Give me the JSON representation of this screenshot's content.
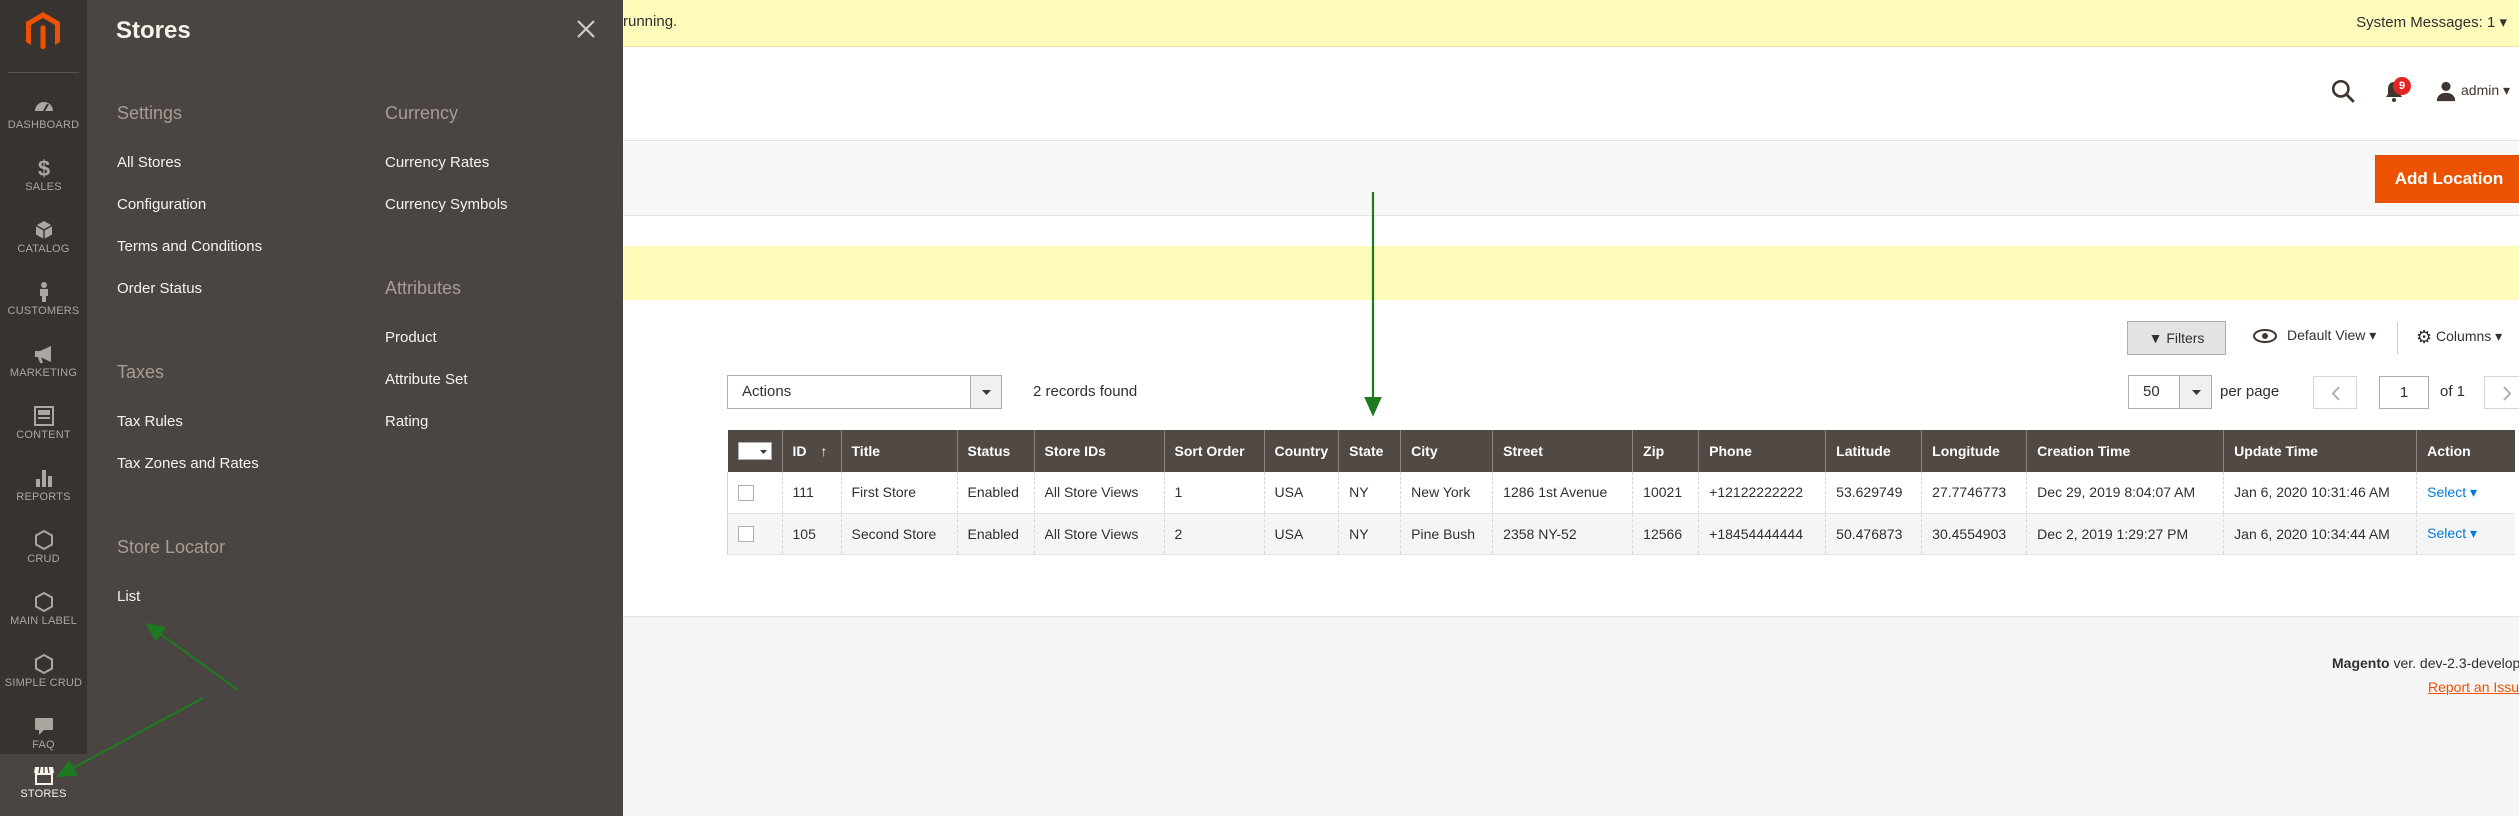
{
  "notice": {
    "text": "running.",
    "system_messages": "System Messages: 1"
  },
  "header": {
    "notifications_count": "9",
    "user": "admin"
  },
  "menu": {
    "items": [
      {
        "label": "DASHBOARD",
        "icon": "dashboard-icon"
      },
      {
        "label": "SALES",
        "icon": "dollar-icon"
      },
      {
        "label": "CATALOG",
        "icon": "cube-icon"
      },
      {
        "label": "CUSTOMERS",
        "icon": "person-icon"
      },
      {
        "label": "MARKETING",
        "icon": "megaphone-icon"
      },
      {
        "label": "CONTENT",
        "icon": "layout-icon"
      },
      {
        "label": "REPORTS",
        "icon": "bar-chart-icon"
      },
      {
        "label": "CRUD",
        "icon": "hexagon-icon"
      },
      {
        "label": "MAIN LABEL",
        "icon": "hexagon-icon"
      },
      {
        "label": "SIMPLE CRUD",
        "icon": "hexagon-icon"
      },
      {
        "label": "FAQ",
        "icon": "chat-icon"
      },
      {
        "label": "STORES",
        "icon": "store-icon"
      }
    ]
  },
  "flyout": {
    "title": "Stores",
    "settings": {
      "heading": "Settings",
      "links": [
        "All Stores",
        "Configuration",
        "Terms and Conditions",
        "Order Status"
      ]
    },
    "taxes": {
      "heading": "Taxes",
      "links": [
        "Tax Rules",
        "Tax Zones and Rates"
      ]
    },
    "store_locator": {
      "heading": "Store Locator",
      "links": [
        "List"
      ]
    },
    "currency": {
      "heading": "Currency",
      "links": [
        "Currency Rates",
        "Currency Symbols"
      ]
    },
    "attributes": {
      "heading": "Attributes",
      "links": [
        "Product",
        "Attribute Set",
        "Rating"
      ]
    }
  },
  "page_actions": {
    "add_label": "Add Location"
  },
  "toolbar": {
    "filters": "Filters",
    "default_view": "Default View",
    "columns": "Columns",
    "actions": "Actions",
    "records": "2 records found",
    "per_page_value": "50",
    "per_page_label": "per page",
    "page": "1",
    "of": "of 1"
  },
  "grid": {
    "columns": [
      "ID",
      "Title",
      "Status",
      "Store IDs",
      "Sort Order",
      "Country",
      "State",
      "City",
      "Street",
      "Zip",
      "Phone",
      "Latitude",
      "Longitude",
      "Creation Time",
      "Update Time",
      "Action"
    ],
    "rows": [
      [
        "111",
        "First Store",
        "Enabled",
        "All Store Views",
        "1",
        "USA",
        "NY",
        "New York",
        "1286 1st Avenue",
        "10021",
        "+12122222222",
        "53.629749",
        "27.7746773",
        "Dec 29, 2019 8:04:07 AM",
        "Jan 6, 2020 10:31:46 AM",
        "Select"
      ],
      [
        "105",
        "Second Store",
        "Enabled",
        "All Store Views",
        "2",
        "USA",
        "NY",
        "Pine Bush",
        "2358 NY-52",
        "12566",
        "+18454444444",
        "50.476873",
        "30.4554903",
        "Dec 2, 2019 1:29:27 PM",
        "Jan 6, 2020 10:34:44 AM",
        "Select"
      ]
    ]
  },
  "footer": {
    "brand": "Magento",
    "version": "ver. dev-2.3-develop",
    "report": "Report an Issue"
  },
  "colors": {
    "accent": "#eb5202",
    "menu_bg": "#373330",
    "flyout_bg": "#4a4542",
    "grid_header": "#514943",
    "annotation_arrow": "#1f7a1f"
  }
}
